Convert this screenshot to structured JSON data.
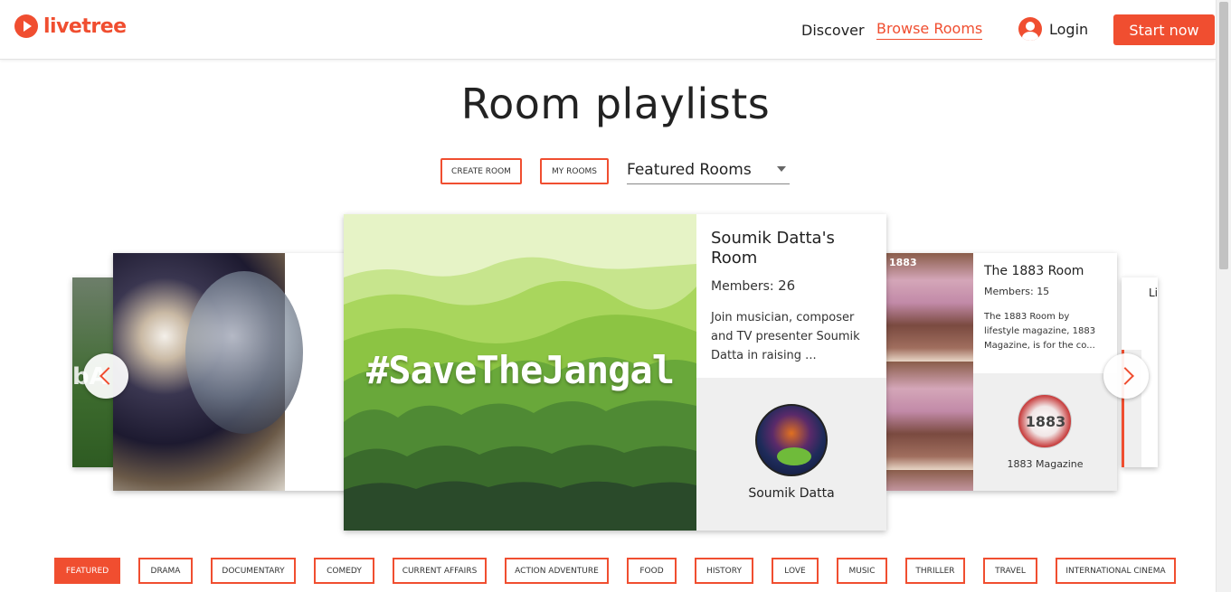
{
  "header": {
    "logo_text": "livetree",
    "nav": {
      "discover": "Discover",
      "browse_rooms": "Browse Rooms"
    },
    "login": "Login",
    "start_now": "Start now"
  },
  "page_title": "Room playlists",
  "controls": {
    "create_room": "CREATE ROOM",
    "my_rooms": "MY ROOMS",
    "filter_selected": "Featured Rooms"
  },
  "carousel": {
    "left_partial_text": "bA",
    "center": {
      "image_text": "#SaveTheJangal",
      "title": "Soumik Datta's Room",
      "members_label": "Members:",
      "members_count": "26",
      "description": "Join musician, composer and TV presenter Soumik Datta in raising ...",
      "owner": "Soumik Datta"
    },
    "right": {
      "title": "The 1883 Room",
      "members_label": "Members:",
      "members_count": "15",
      "description": "The 1883 Room by lifestyle magazine, 1883 Magazine, is for the co...",
      "owner": "1883 Magazine",
      "avatar_text": "1883",
      "mag_label": "1883"
    },
    "far_right_partial_title": "Li"
  },
  "categories": [
    "FEATURED",
    "DRAMA",
    "DOCUMENTARY",
    "COMEDY",
    "CURRENT AFFAIRS",
    "ACTION ADVENTURE",
    "FOOD",
    "HISTORY",
    "LOVE",
    "MUSIC",
    "THRILLER",
    "TRAVEL",
    "INTERNATIONAL CINEMA"
  ],
  "colors": {
    "brand": "#f04e30",
    "panel_gray": "#efefef"
  }
}
